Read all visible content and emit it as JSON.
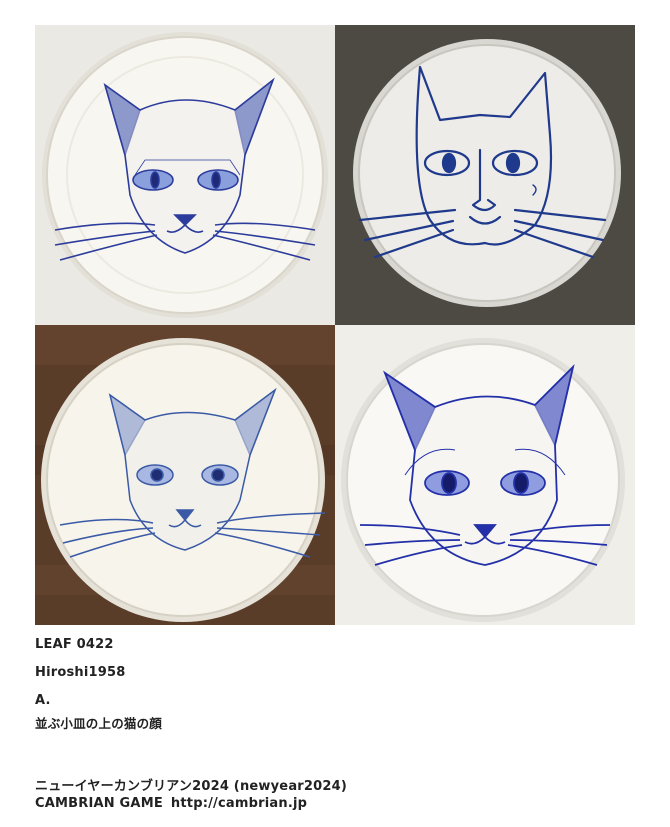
{
  "artwork": {
    "panels": [
      {
        "subject": "cat-face-plate-shaded-sketch",
        "background": "#ebe9e4",
        "ink": "#2c3c9c"
      },
      {
        "subject": "cat-face-plate-simple-line",
        "background": "#55524c",
        "ink": "#1f3a8c"
      },
      {
        "subject": "cat-face-plate-light-sketch",
        "background": "#5a3d28",
        "ink": "#3a5aa6"
      },
      {
        "subject": "cat-face-plate-bold-sketch",
        "background": "#efeee9",
        "ink": "#2330a8"
      }
    ]
  },
  "caption": {
    "leaf": "LEAF 0422",
    "author": "Hiroshi1958",
    "letter": "A.",
    "title": "並ぶ小皿の上の猫の顔",
    "event": "ニューイヤーカンブリアン2024 (newyear2024)",
    "game": "CAMBRIAN GAME",
    "url": "http://cambrian.jp"
  }
}
